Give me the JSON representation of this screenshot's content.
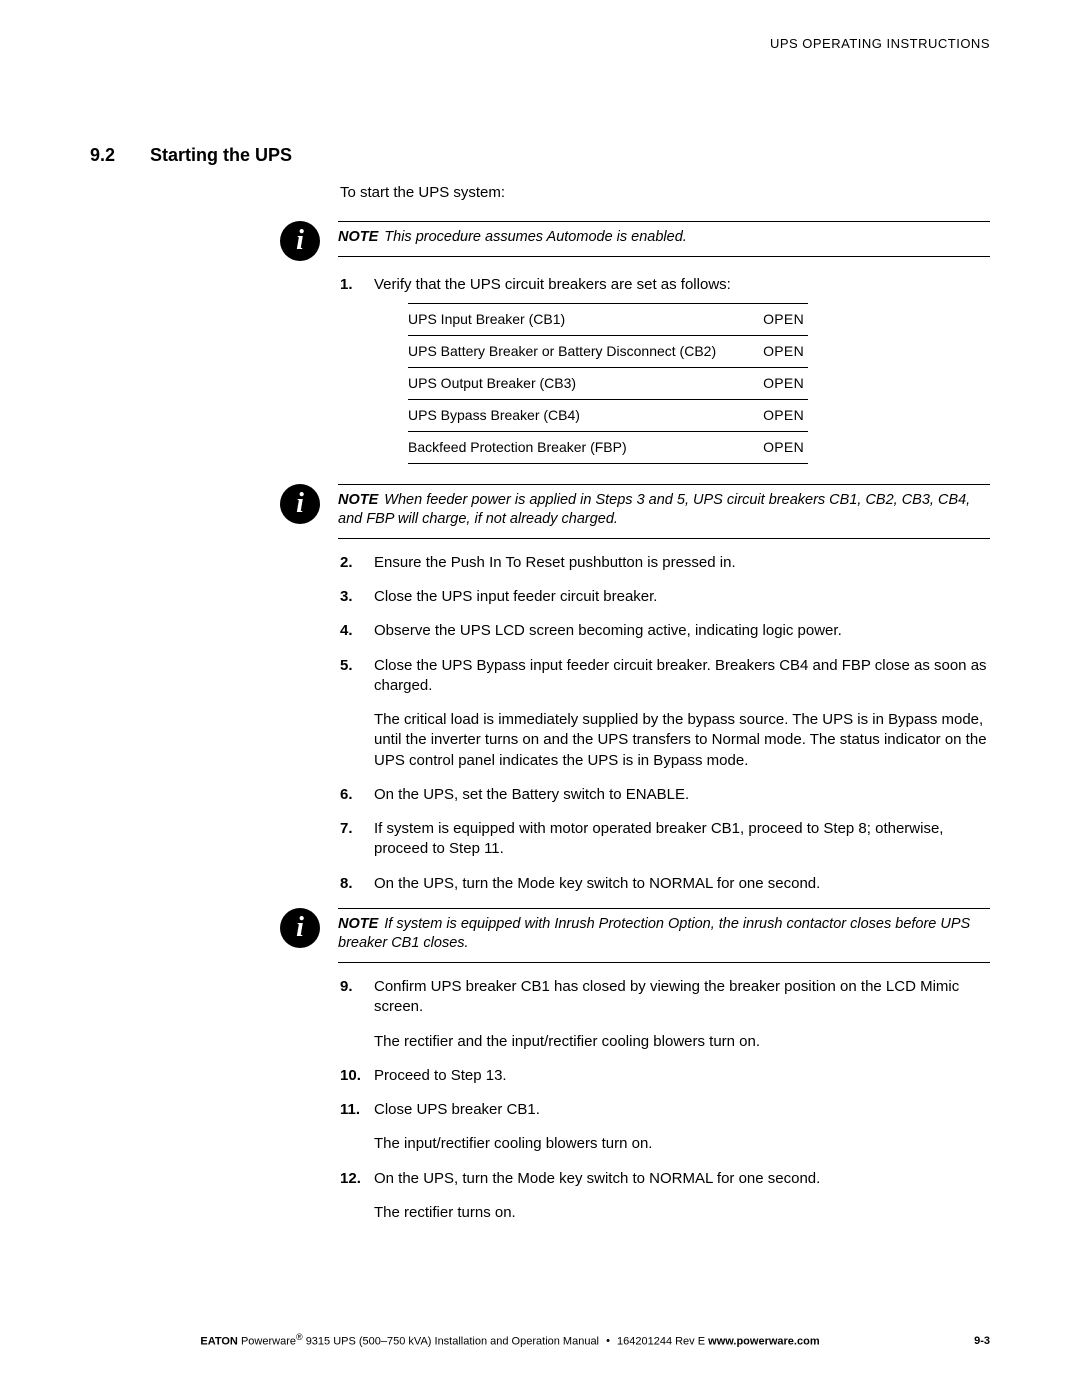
{
  "header": {
    "running_head": "UPS OPERATING INSTRUCTIONS"
  },
  "section": {
    "number": "9.2",
    "title": "Starting the UPS"
  },
  "intro": "To start the UPS system:",
  "note1": {
    "label": "NOTE",
    "text": "This procedure assumes Automode is enabled."
  },
  "step1": {
    "text": "Verify that the UPS circuit breakers are set as follows:",
    "table": [
      {
        "name": "UPS Input Breaker (CB1)",
        "state": "OPEN"
      },
      {
        "name": "UPS Battery Breaker or Battery Disconnect (CB2)",
        "state": "OPEN"
      },
      {
        "name": "UPS Output Breaker (CB3)",
        "state": "OPEN"
      },
      {
        "name": "UPS Bypass Breaker (CB4)",
        "state": "OPEN"
      },
      {
        "name": "Backfeed Protection Breaker (FBP)",
        "state": "OPEN"
      }
    ]
  },
  "note2": {
    "label": "NOTE",
    "text": "When feeder power is applied in Steps 3 and 5, UPS circuit breakers CB1, CB2, CB3, CB4, and FBP will charge, if not already charged."
  },
  "step2": "Ensure the Push In To Reset pushbutton is pressed in.",
  "step3": "Close the UPS input feeder circuit breaker.",
  "step4": "Observe the UPS LCD screen becoming active, indicating logic power.",
  "step5": {
    "p1": "Close the UPS Bypass input feeder circuit breaker. Breakers CB4 and FBP close as soon as charged.",
    "p2": "The critical load is immediately supplied by the bypass source. The UPS is in Bypass mode, until the inverter turns on and the UPS transfers to Normal mode. The status indicator on the UPS control panel indicates the UPS is in Bypass mode."
  },
  "step6": "On the UPS, set the Battery switch to ENABLE.",
  "step7": "If system is equipped with motor operated breaker CB1, proceed to Step 8; otherwise, proceed to Step 11.",
  "step8": "On the UPS, turn the Mode key switch to NORMAL for one second.",
  "note3": {
    "label": "NOTE",
    "text": "If system is equipped with Inrush Protection Option, the inrush contactor closes before UPS breaker CB1 closes."
  },
  "step9": {
    "p1": "Confirm UPS breaker CB1 has closed by viewing the breaker position on the LCD Mimic screen.",
    "p2": "The rectifier and the input/rectifier cooling blowers turn on."
  },
  "step10": "Proceed to Step 13.",
  "step11": {
    "p1": "Close UPS breaker CB1.",
    "p2": "The input/rectifier cooling blowers turn on."
  },
  "step12": {
    "p1": "On the UPS, turn the Mode key switch to NORMAL for one second.",
    "p2": "The rectifier turns on."
  },
  "footer": {
    "brand": "EATON",
    "product": "Powerware",
    "reg": "®",
    "doc": "9315 UPS (500–750 kVA) Installation and Operation Manual",
    "docnum": "164201244 Rev E",
    "url": "www.powerware.com",
    "page": "9-3"
  }
}
